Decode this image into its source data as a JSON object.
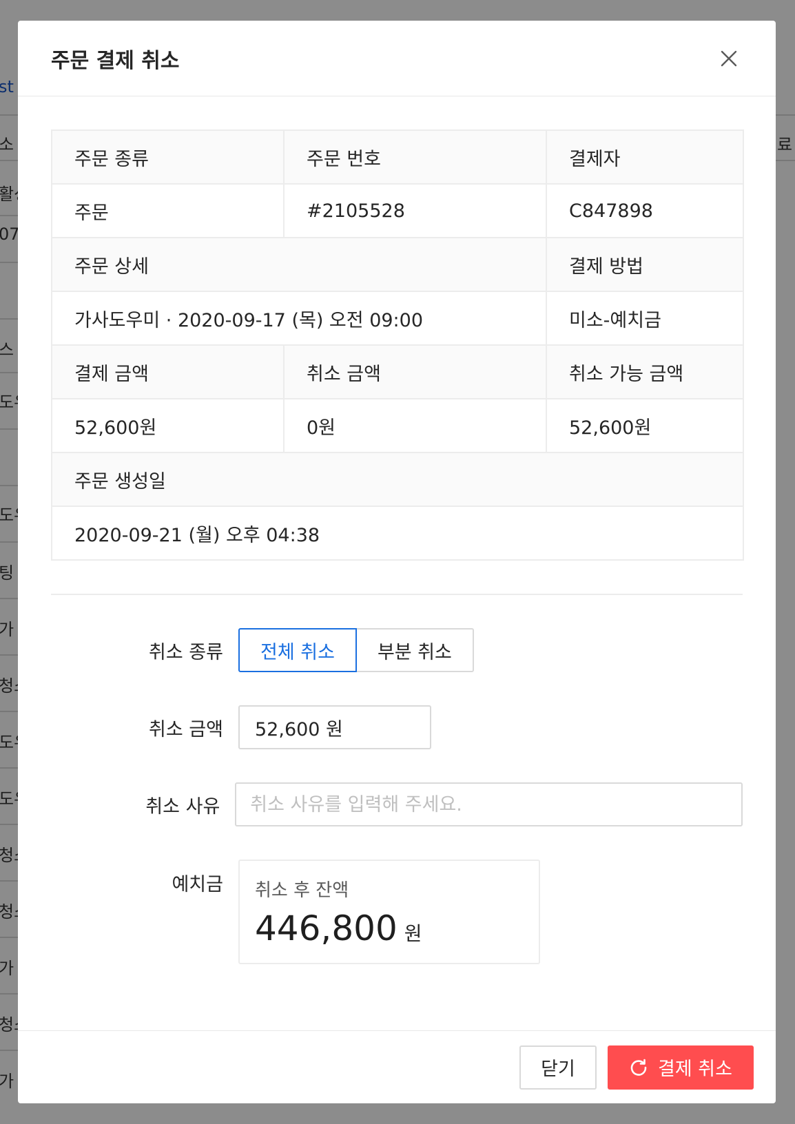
{
  "background": {
    "left_fragments": [
      "st",
      "소",
      "활성",
      "07",
      "스",
      "도우",
      "도우",
      "팅",
      "가",
      "청소",
      "도우",
      "도우",
      "청소",
      "청소",
      "가",
      "청소",
      "가"
    ],
    "right_fragments": [
      "료"
    ]
  },
  "modal": {
    "title": "주문 결제 취소",
    "close_icon": "close-icon"
  },
  "order_info": {
    "row1_headers": [
      "주문 종류",
      "주문 번호",
      "결제자"
    ],
    "row1_values": [
      "주문",
      "#2105528",
      "C847898"
    ],
    "row2_headers": [
      "주문 상세",
      "결제 방법"
    ],
    "row2_values": [
      "가사도우미 · 2020-09-17 (목) 오전 09:00",
      "미소-예치금"
    ],
    "row3_headers": [
      "결제 금액",
      "취소 금액",
      "취소 가능 금액"
    ],
    "row3_values": [
      "52,600원",
      "0원",
      "52,600원"
    ],
    "row4_header": "주문 생성일",
    "row4_value": "2020-09-21 (월) 오후 04:38"
  },
  "form": {
    "cancel_type_label": "취소 종류",
    "cancel_type_options": [
      "전체 취소",
      "부분 취소"
    ],
    "cancel_type_selected": "전체 취소",
    "cancel_amount_label": "취소 금액",
    "cancel_amount_value": "52,600 원",
    "reason_label": "취소 사유",
    "reason_value": "",
    "reason_placeholder": "취소 사유를 입력해 주세요.",
    "deposit_label": "예치금",
    "deposit_caption": "취소 후 잔액",
    "deposit_amount": "446,800",
    "deposit_unit": "원"
  },
  "footer": {
    "close_label": "닫기",
    "confirm_label": "결제 취소",
    "confirm_icon": "reload-icon"
  },
  "colors": {
    "accent": "#1a6fe0",
    "danger": "#ff4d4f",
    "overlay": "#7f7f7f"
  }
}
